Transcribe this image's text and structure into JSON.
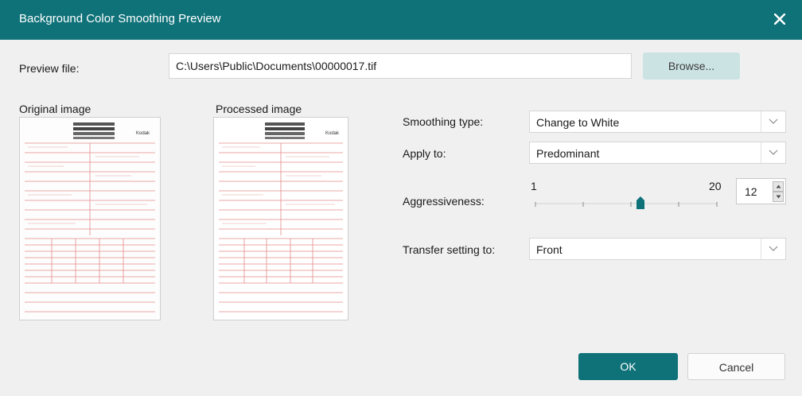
{
  "dialog": {
    "title": "Background Color Smoothing Preview"
  },
  "preview_file": {
    "label": "Preview file:",
    "value": "C:\\Users\\Public\\Documents\\00000017.tif",
    "browse_label": "Browse..."
  },
  "images": {
    "original_label": "Original image",
    "processed_label": "Processed image",
    "logo_text": "Kodak"
  },
  "settings": {
    "smoothing_type": {
      "label": "Smoothing type:",
      "value": "Change to White"
    },
    "apply_to": {
      "label": "Apply to:",
      "value": "Predominant"
    },
    "aggressiveness": {
      "label": "Aggressiveness:",
      "min_label": "1",
      "max_label": "20",
      "value": "12",
      "min": 1,
      "max": 20
    },
    "transfer_setting": {
      "label": "Transfer setting to:",
      "value": "Front"
    }
  },
  "footer": {
    "ok_label": "OK",
    "cancel_label": "Cancel"
  },
  "colors": {
    "accent": "#0f7279",
    "browse_bg": "#cce3e3",
    "form_lines": "#e58a8a"
  },
  "icons": [
    "close-icon",
    "chevron-down-icon",
    "spin-up-icon",
    "spin-down-icon",
    "slider-thumb"
  ]
}
